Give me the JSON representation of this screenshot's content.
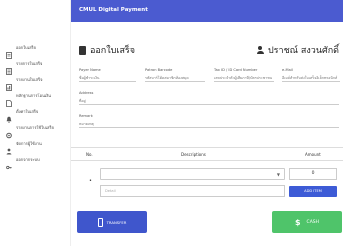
{
  "sidebar": {
    "items": [
      {
        "label": "ออกใบเสร็จ",
        "icon": "receipt-icon",
        "color": "#555555"
      },
      {
        "label": "รายการใบเสร็จ",
        "icon": "list-icon",
        "color": "#555555"
      },
      {
        "label": "รายงานใบเสร็จ",
        "icon": "report-icon",
        "color": "#555555"
      },
      {
        "label": "หลักฐานการโอนเงิน",
        "icon": "document-icon",
        "color": "#555555"
      },
      {
        "label": "ตั้งค่าใบเสร็จ",
        "icon": "bell-icon",
        "color": "#555555"
      },
      {
        "label": "รายงานการใช้ใบเสร็จ",
        "icon": "settings-icon",
        "color": "#555555"
      },
      {
        "label": "จัดการผู้ใช้งาน",
        "icon": "user-icon",
        "color": "#555555"
      },
      {
        "label": "ออกจากระบบ",
        "icon": "key-icon",
        "color": "#555555"
      }
    ]
  },
  "topbar": {
    "title": "CMUL Digital Payment",
    "color": "#4b5bd0"
  },
  "page": {
    "title": "ออกใบเสร็จ",
    "user": "ปราชณ์ สงวนศักดิ์"
  },
  "form": {
    "payer_name": {
      "label": "Payer Name",
      "placeholder": "ชื่อผู้ชำระเงิน"
    },
    "patron_barcode": {
      "label": "Patron Barcode",
      "placeholder": "รหัสบาร์โค้ดสมาชิกห้องสมุด"
    },
    "tax_id": {
      "label": "Tax ID / ID Card Number",
      "placeholder": "เลขประจำตัวผู้เสียภาษี/บัตรประชาชน"
    },
    "email": {
      "label": "e-Mail",
      "placeholder": "อีเมล์สำหรับส่งใบเสร็จอิเล็กทรอนิกส์"
    },
    "address": {
      "label": "Address",
      "placeholder": "ที่อยู่"
    },
    "remark": {
      "label": "Remark",
      "placeholder": "หมายเหตุ"
    }
  },
  "table": {
    "headers": {
      "no": "No.",
      "descriptions": "Descriptions",
      "amount": "Amount"
    },
    "row": {
      "bullet": "•",
      "detail_placeholder": "Detail",
      "amount_value": "0",
      "add_label": "ADD ITEM"
    }
  },
  "actions": {
    "transfer_label": "TRANSFER",
    "transfer_color": "#3f56cc",
    "cash_label": "CASH",
    "cash_color": "#4fc46a"
  }
}
